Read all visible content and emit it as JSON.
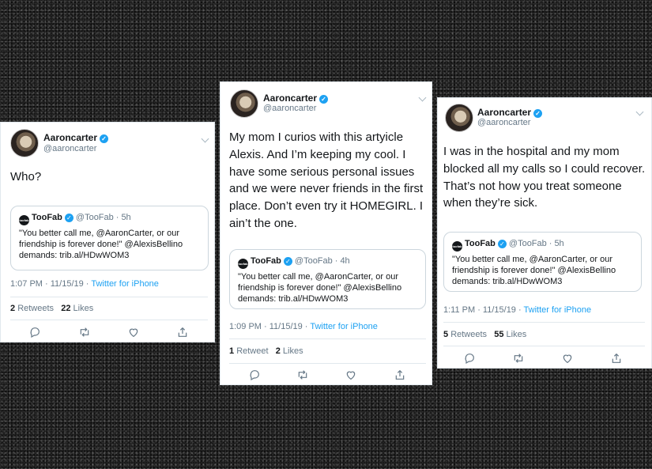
{
  "colors": {
    "accent": "#1da1f2",
    "text": "#14171a",
    "muted": "#657786",
    "border": "#e1e8ed"
  },
  "tweets": [
    {
      "name": "Aaroncarter",
      "handle": "@aaroncarter",
      "text": "Who?",
      "quote": {
        "logo": "toofab",
        "name": "TooFab",
        "handle": "@TooFab",
        "time": "5h",
        "text": "\"You better call me, @AaronCarter, or our friendship is forever done!\" @AlexisBellino demands: trib.al/HDwWOM3"
      },
      "timestamp": "1:07 PM · 11/15/19 · ",
      "source": "Twitter for iPhone",
      "retweets_count": "2",
      "retweets_label": "Retweets",
      "likes_count": "22",
      "likes_label": "Likes"
    },
    {
      "name": "Aaroncarter",
      "handle": "@aaroncarter",
      "text": "My mom I curios with this artyicle Alexis. And I’m keeping my cool. I have some serious personal issues and we were never friends in the first place. Don’t even try it HOMEGIRL. I ain’t the one.",
      "quote": {
        "logo": "toofab",
        "name": "TooFab",
        "handle": "@TooFab",
        "time": "4h",
        "text": "\"You better call me, @AaronCarter, or our friendship is forever done!\" @AlexisBellino demands: trib.al/HDwWOM3"
      },
      "timestamp": "1:09 PM · 11/15/19 · ",
      "source": "Twitter for iPhone",
      "retweets_count": "1",
      "retweets_label": "Retweet",
      "likes_count": "2",
      "likes_label": "Likes"
    },
    {
      "name": "Aaroncarter",
      "handle": "@aaroncarter",
      "text": "I was in the hospital and my mom blocked all my calls so I could recover. That’s not how you treat someone when they’re sick.",
      "quote": {
        "logo": "toofab",
        "name": "TooFab",
        "handle": "@TooFab",
        "time": "5h",
        "text": "\"You better call me, @AaronCarter, or our friendship is forever done!\" @AlexisBellino demands: trib.al/HDwWOM3"
      },
      "timestamp": "1:11 PM · 11/15/19 · ",
      "source": "Twitter for iPhone",
      "retweets_count": "5",
      "retweets_label": "Retweets",
      "likes_count": "55",
      "likes_label": "Likes"
    }
  ],
  "icons": [
    "reply-icon",
    "retweet-icon",
    "like-icon",
    "share-icon",
    "verified-icon",
    "chevron-down-icon"
  ]
}
